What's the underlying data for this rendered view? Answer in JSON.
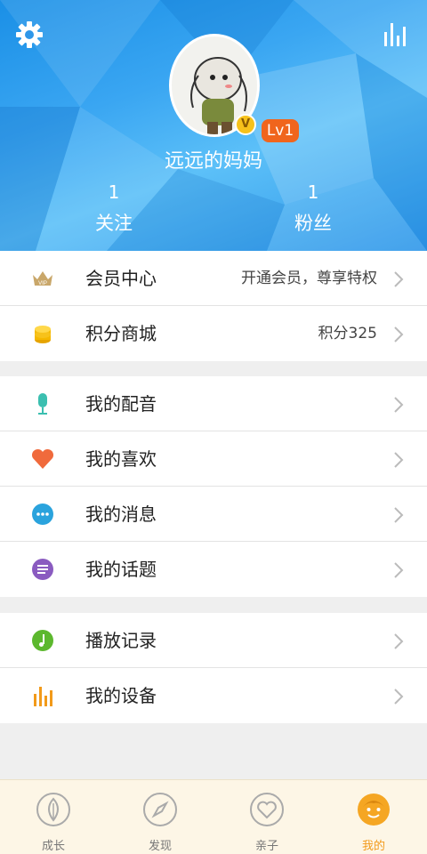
{
  "profile": {
    "username": "远远的妈妈",
    "level": "Lv1",
    "vip_badge": "V",
    "following_count": "1",
    "following_label": "关注",
    "followers_count": "1",
    "followers_label": "粉丝"
  },
  "header_icons": {
    "left": "gear-icon",
    "right": "stats-icon"
  },
  "menu": {
    "group1": [
      {
        "label": "会员中心",
        "extra": "开通会员，尊享特权",
        "icon": "vip-crown-icon"
      },
      {
        "label": "积分商城",
        "extra": "积分325",
        "icon": "coins-icon"
      }
    ],
    "group2": [
      {
        "label": "我的配音",
        "icon": "microphone-icon"
      },
      {
        "label": "我的喜欢",
        "icon": "heart-icon"
      },
      {
        "label": "我的消息",
        "icon": "message-icon"
      },
      {
        "label": "我的话题",
        "icon": "topic-icon"
      }
    ],
    "group3": [
      {
        "label": "播放记录",
        "icon": "music-note-icon"
      },
      {
        "label": "我的设备",
        "icon": "equalizer-icon"
      }
    ]
  },
  "tabs": [
    {
      "label": "成长",
      "icon": "leaf-icon",
      "active": false
    },
    {
      "label": "发现",
      "icon": "compass-icon",
      "active": false
    },
    {
      "label": "亲子",
      "icon": "heart-outline-icon",
      "active": false
    },
    {
      "label": "我的",
      "icon": "face-icon",
      "active": true
    }
  ],
  "colors": {
    "header_blue": "#2f97e9",
    "level_orange": "#f0651d",
    "active_tab": "#f29a1a",
    "tabbar_bg": "#fdf6e6"
  }
}
